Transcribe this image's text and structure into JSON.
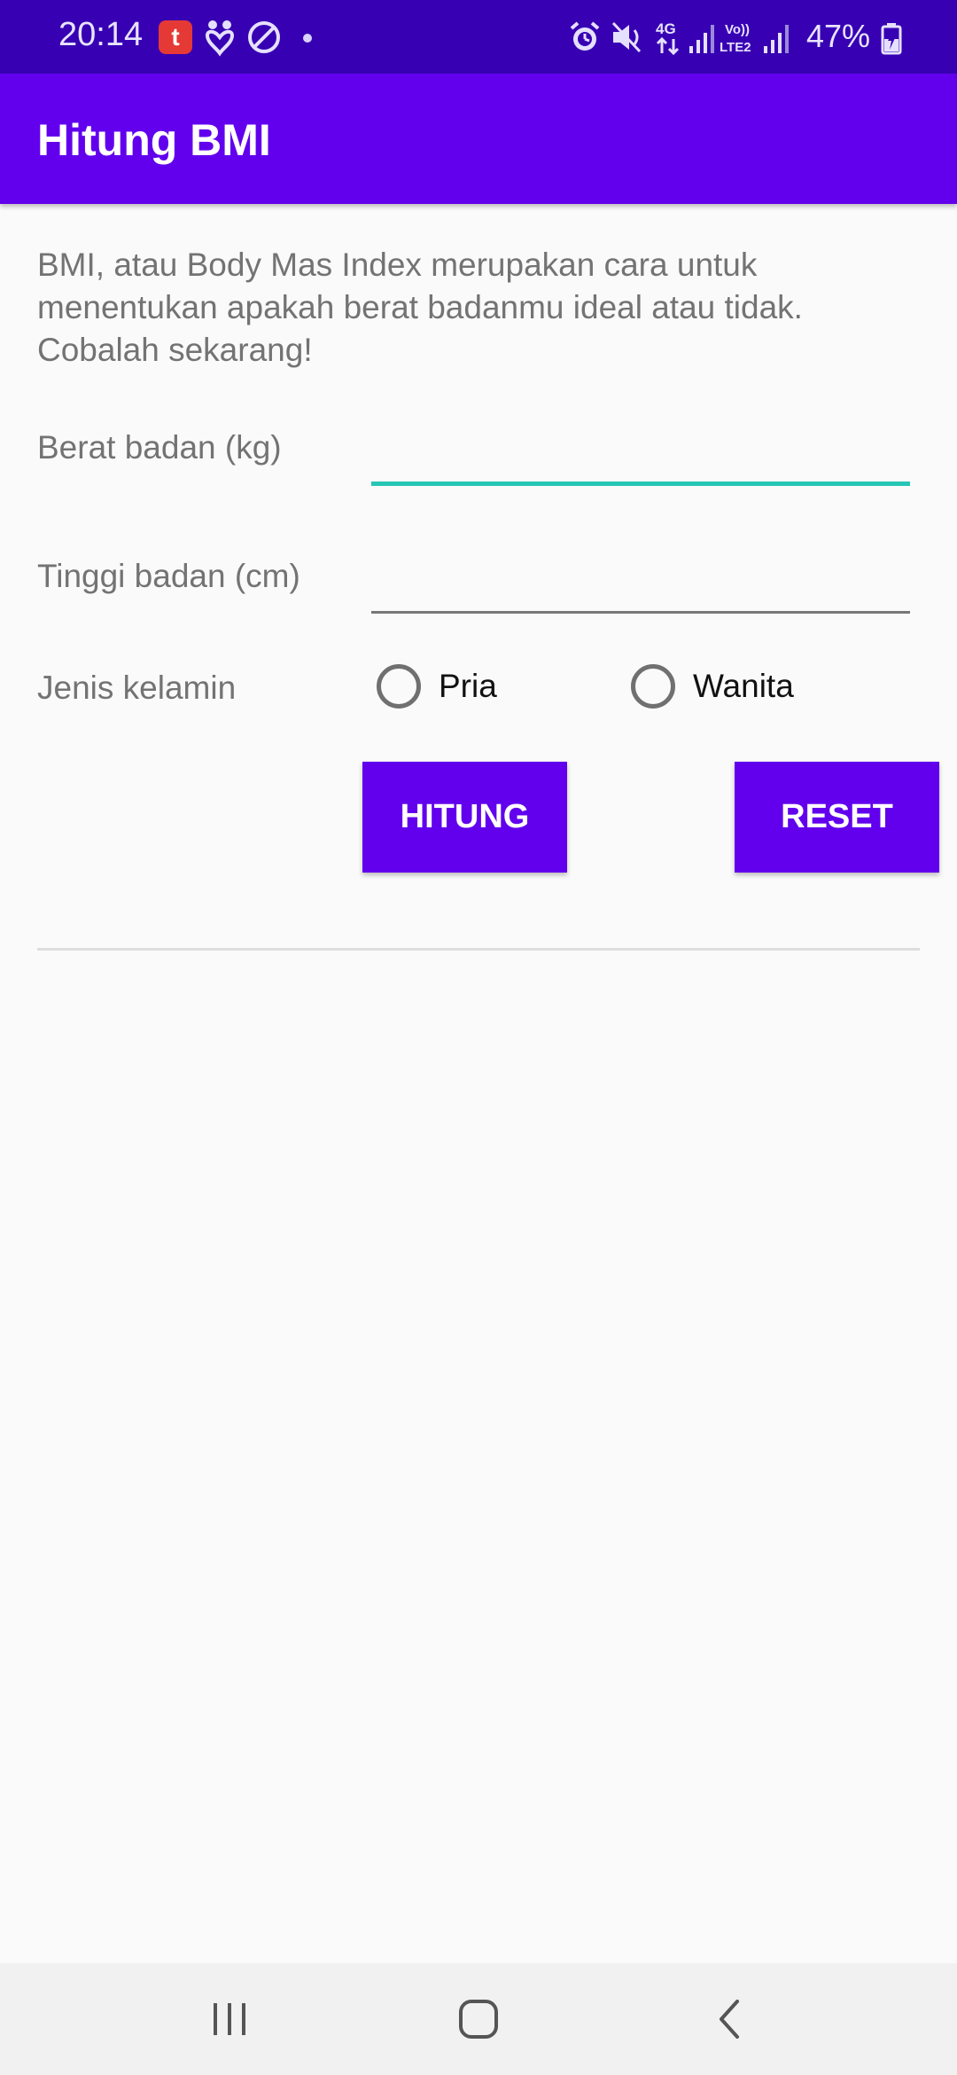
{
  "status_bar": {
    "time": "20:14",
    "app_icon": "telkomsel-app-icon",
    "battery_percent": "47%",
    "icons": [
      "heart-notification-icon",
      "do-not-disturb-icon",
      "alarm-icon",
      "mute-icon",
      "4g-data-icon",
      "signal-icon",
      "volte-icon",
      "signal-2-icon",
      "battery-charging-icon"
    ]
  },
  "app_bar": {
    "title": "Hitung BMI"
  },
  "main": {
    "intro": "BMI, atau Body Mas Index merupakan cara untuk menentukan apakah berat badanmu ideal atau tidak. Cobalah sekarang!",
    "weight_label": "Berat badan (kg)",
    "weight_value": "",
    "height_label": "Tinggi badan (cm)",
    "height_value": "",
    "gender_label": "Jenis kelamin",
    "gender_options": [
      "Pria",
      "Wanita"
    ],
    "calculate_label": "HITUNG",
    "reset_label": "RESET",
    "result": ""
  },
  "nav_bar": {
    "icons": [
      "recent-apps-icon",
      "home-icon",
      "back-icon"
    ]
  },
  "colors": {
    "status_bar": "#3700b3",
    "primary": "#6200ee",
    "focused_underline": "#26c6b5",
    "text_secondary": "#737373",
    "background": "#fafafa"
  }
}
